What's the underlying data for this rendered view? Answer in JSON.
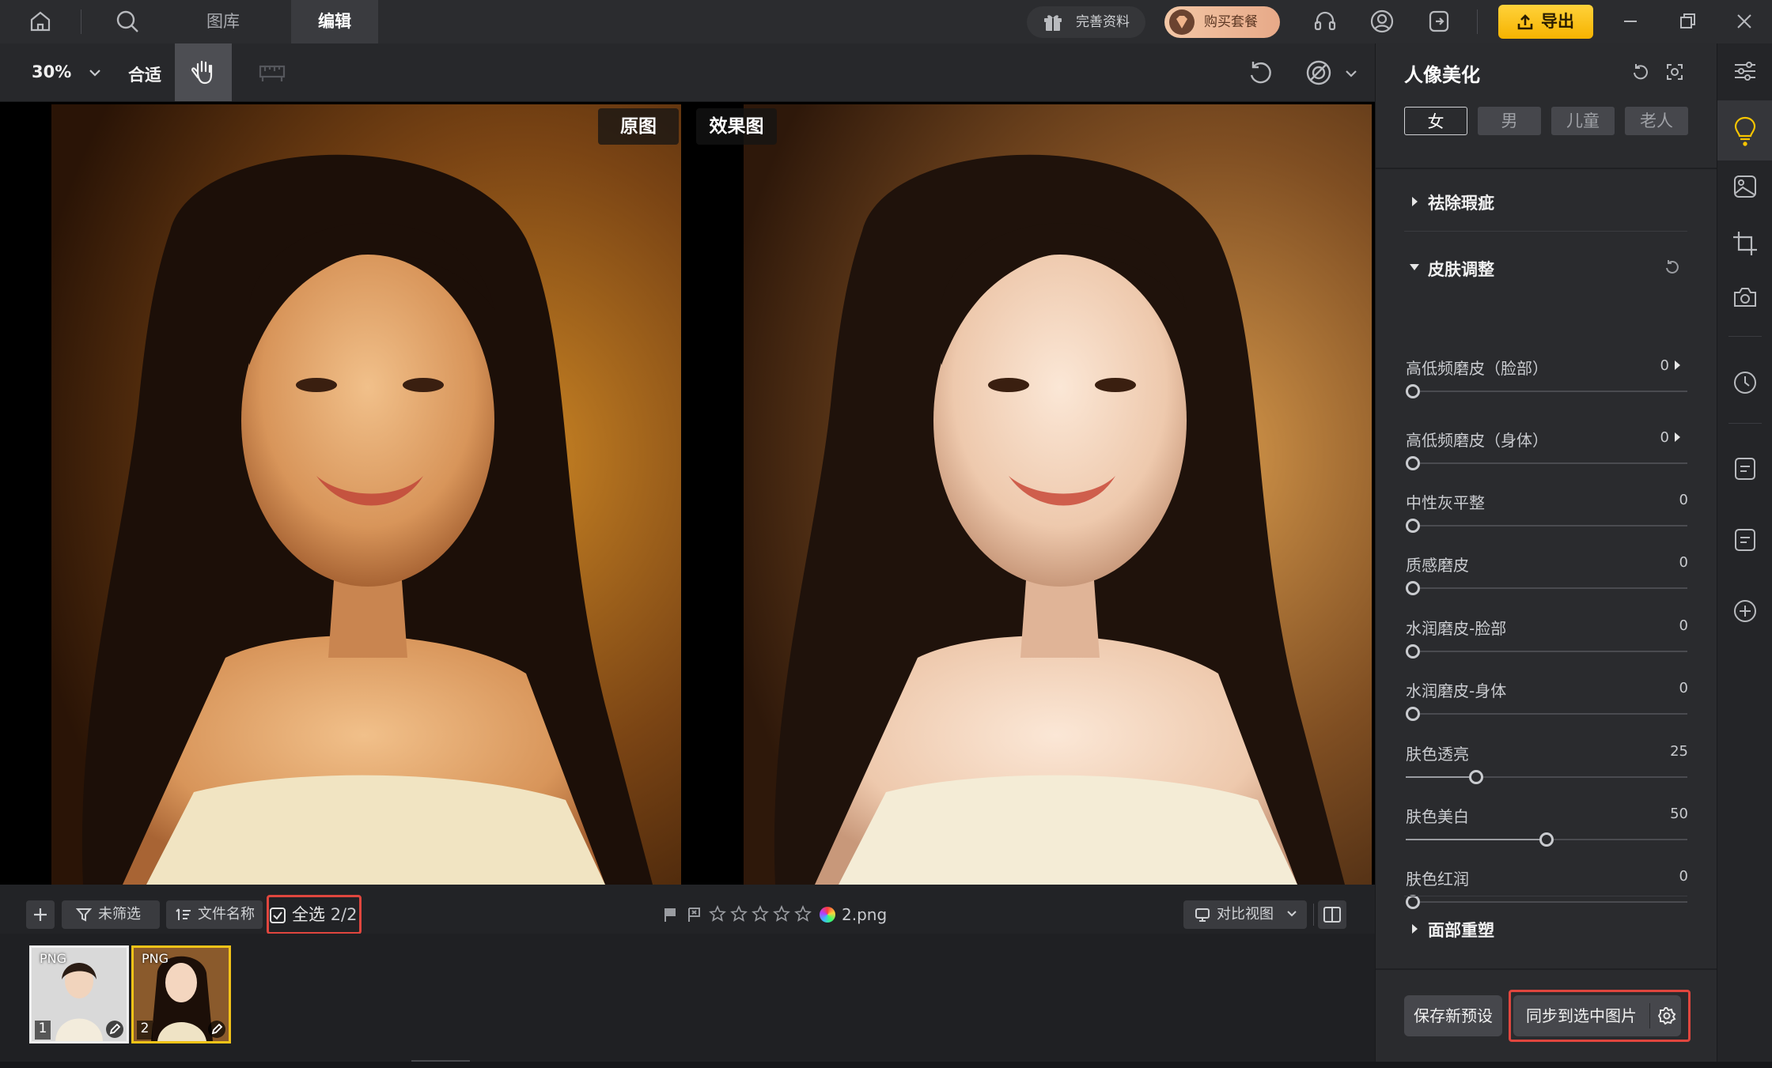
{
  "topbar": {
    "tabs": [
      {
        "label": "图库"
      },
      {
        "label": "编辑"
      }
    ],
    "complete_label": "完善资料",
    "buy_label": "购买套餐",
    "export_label": "导出"
  },
  "toolbar": {
    "zoom": "30%",
    "fit_label": "合适"
  },
  "canvas": {
    "original_label": "原图",
    "effect_label": "效果图"
  },
  "bottombar": {
    "filter_label": "未筛选",
    "sort_label": "文件名称",
    "select_all_label": "全选",
    "select_count": "2/2",
    "filename": "2.png",
    "rating_stars": 0,
    "view_label": "对比视图"
  },
  "filmstrip": [
    {
      "format": "PNG",
      "index": "1",
      "selected": false
    },
    {
      "format": "PNG",
      "index": "2",
      "selected": true
    }
  ],
  "panel": {
    "title": "人像美化",
    "segments": [
      "女",
      "男",
      "儿童",
      "老人"
    ],
    "active_segment": 0,
    "sections": {
      "blemish": "祛除瑕疵",
      "skin": "皮肤调整",
      "face": "面部重塑"
    },
    "sliders": [
      {
        "label": "高低频磨皮（脸部）",
        "value": "0",
        "arrow": true,
        "pct": 0
      },
      {
        "label": "高低频磨皮（身体）",
        "value": "0",
        "arrow": true,
        "pct": 0
      },
      {
        "label": "中性灰平整",
        "value": "0",
        "arrow": false,
        "pct": 0
      },
      {
        "label": "质感磨皮",
        "value": "0",
        "arrow": false,
        "pct": 0
      },
      {
        "label": "水润磨皮-脸部",
        "value": "0",
        "arrow": false,
        "pct": 0
      },
      {
        "label": "水润磨皮-身体",
        "value": "0",
        "arrow": false,
        "pct": 0
      },
      {
        "label": "肤色透亮",
        "value": "25",
        "arrow": false,
        "pct": 25
      },
      {
        "label": "肤色美白",
        "value": "50",
        "arrow": false,
        "pct": 50
      },
      {
        "label": "肤色红润",
        "value": "0",
        "arrow": false,
        "pct": 0
      }
    ],
    "save_preset_label": "保存新预设",
    "sync_label": "同步到选中图片"
  },
  "colors": {
    "accent": "#f6b300",
    "highlight": "#e0463e",
    "selected_thumb": "#f2c318"
  }
}
